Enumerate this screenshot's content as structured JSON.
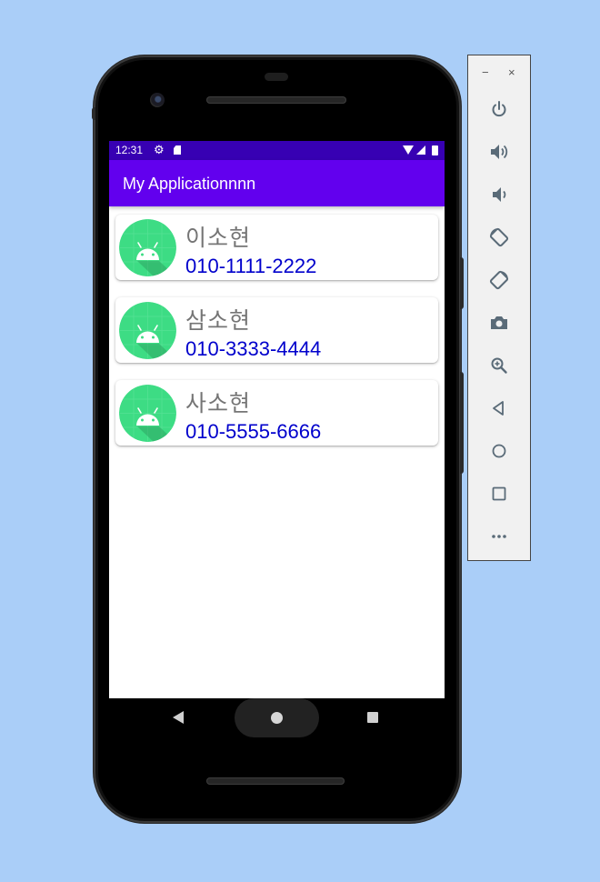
{
  "status_bar": {
    "time": "12:31",
    "icons": [
      "gear-icon",
      "sd-card-icon",
      "wifi-icon",
      "cell-signal-icon",
      "battery-icon"
    ]
  },
  "app_bar": {
    "title": "My Applicationnnn"
  },
  "contacts": [
    {
      "name": "이소현",
      "phone": "010-1111-2222"
    },
    {
      "name": "삼소현",
      "phone": "010-3333-4444"
    },
    {
      "name": "사소현",
      "phone": "010-5555-6666"
    }
  ],
  "nav_bar": {
    "buttons": [
      "back-icon",
      "home-icon",
      "recents-icon"
    ]
  },
  "emulator_toolbar": {
    "window_controls": {
      "minimize": "−",
      "close": "×"
    },
    "buttons": [
      "power-icon",
      "volume-up-icon",
      "volume-down-icon",
      "rotate-left-icon",
      "rotate-right-icon",
      "camera-icon",
      "zoom-icon",
      "back-icon",
      "home-icon",
      "overview-icon",
      "more-icon"
    ]
  },
  "colors": {
    "background": "#aacef8",
    "status_bar": "#3700b3",
    "app_bar": "#6200ee",
    "name_text": "#757575",
    "phone_text": "#0000cc",
    "avatar_green": "#3ddc84"
  }
}
